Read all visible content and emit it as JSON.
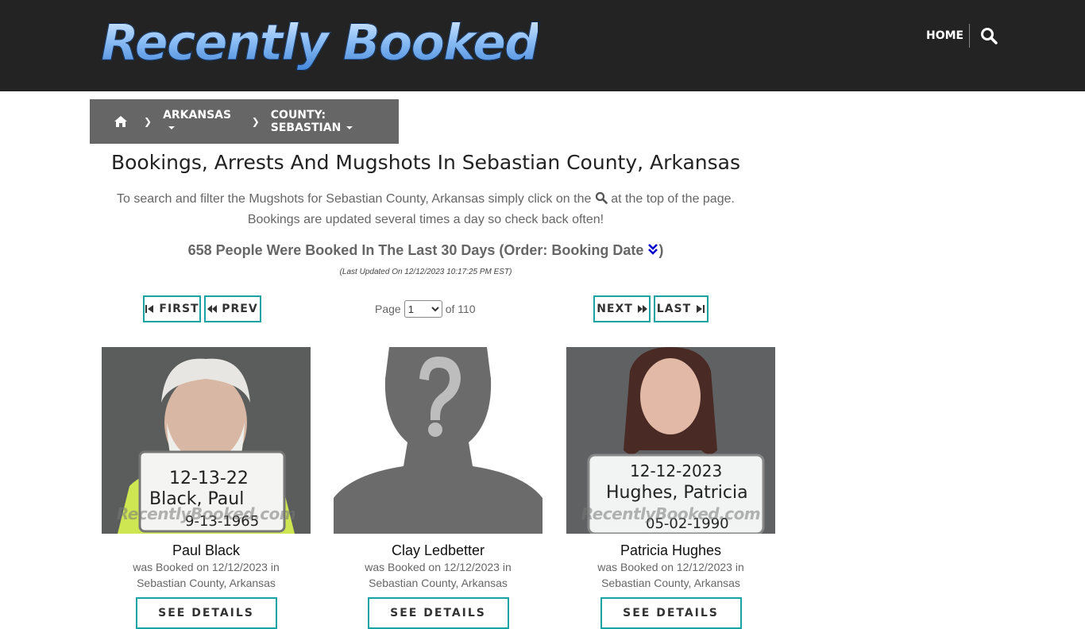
{
  "header": {
    "logo_text": "Recently Booked",
    "nav_home": "HOME",
    "search_icon": "search-icon"
  },
  "breadcrumb": {
    "home_icon": "home-icon",
    "state": "ARKANSAS",
    "county": "COUNTY: SEBASTIAN"
  },
  "page": {
    "title": "Bookings, Arrests And Mugshots In Sebastian County, Arkansas",
    "intro_part1": "To search and filter the Mugshots for Sebastian County, Arkansas simply click on the",
    "intro_part2": "at the top of the page.",
    "intro_line2": "Bookings are updated several times a day so check back often!",
    "count_text": "658 People Were Booked In The Last 30 Days (Order: Booking Date",
    "count_close": ")",
    "last_updated": "(Last Updated On 12/12/2023 10:17:25 PM EST)"
  },
  "pagination": {
    "first": "FIRST",
    "prev": "PREV",
    "page_label": "Page",
    "current_page": "1",
    "of_label": "of 110",
    "next": "NEXT",
    "last": "LAST"
  },
  "people": [
    {
      "name": "Paul Black",
      "booked_line": "was Booked on 12/12/2023 in",
      "location": "Sebastian County, Arkansas",
      "details_label": "SEE DETAILS"
    },
    {
      "name": "Clay Ledbetter",
      "booked_line": "was Booked on 12/12/2023 in",
      "location": "Sebastian County, Arkansas",
      "details_label": "SEE DETAILS"
    },
    {
      "name": "Patricia Hughes",
      "booked_line": "was Booked on 12/12/2023 in",
      "location": "Sebastian County, Arkansas",
      "details_label": "SEE DETAILS"
    }
  ],
  "mugshot_text": {
    "watermark": "RecentlyBooked.com",
    "card1_date": "12-13-22",
    "card1_name": "Black, Paul",
    "card1_dob": "9-13-1965",
    "card3_date": "12-12-2023",
    "card3_name": "Hughes, Patricia",
    "card3_dob": "05-02-1990"
  },
  "colors": {
    "topbar": "#232323",
    "breadcrumb_bg": "#666666",
    "accent_teal": "#1aa3a3",
    "order_icon_blue": "#0000cc"
  }
}
